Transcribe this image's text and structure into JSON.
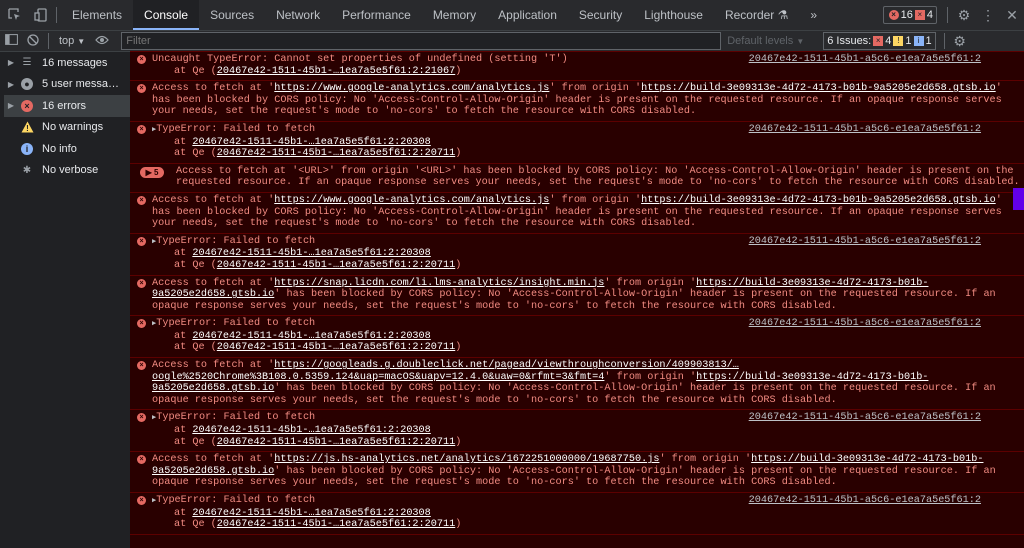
{
  "tabs": {
    "elements": "Elements",
    "console": "Console",
    "sources": "Sources",
    "network": "Network",
    "performance": "Performance",
    "memory": "Memory",
    "application": "Application",
    "security": "Security",
    "lighthouse": "Lighthouse",
    "recorder": "Recorder",
    "more": "»"
  },
  "header_badges": {
    "errors": "16",
    "issues": "4"
  },
  "toolbar": {
    "context": "top",
    "filter_placeholder": "Filter",
    "levels": "Default levels",
    "issues_label": "6 Issues:",
    "issues_err": "4",
    "issues_warn": "1",
    "issues_info": "1"
  },
  "sidebar": {
    "messages": "16 messages",
    "user": "5 user messa…",
    "errors": "16 errors",
    "warnings": "No warnings",
    "info": "No info",
    "verbose": "No verbose"
  },
  "log": {
    "src": "20467e42-1511-45b1-a5c6-e1ea7a5e5f61:2",
    "m1_text": "Uncaught TypeError: Cannot set properties of undefined (setting 'T')",
    "m1_at": "at Qe (",
    "m1_link": "20467e42-1511-45b1-…1ea7a5e5f61:2:21067",
    "tf_text": "TypeError: Failed to fetch",
    "tf_at1": "at ",
    "tf_link1": "20467e42-1511-45b1-…1ea7a5e5f61:2:20308",
    "tf_at2": "at Qe (",
    "tf_link2": "20467e42-1511-45b1-…1ea7a5e5f61:2:20711",
    "p_access": "Access to fetch at '",
    "p_from": "' from origin '",
    "p_blocked": "' has been blocked by CORS policy: No 'Access-Control-Allow-Origin' header is present on the requested resource. If an opaque response serves your needs, set the request's mode to 'no-cors' to fetch the resource with CORS disabled.",
    "origin": "https://build-3e09313e-4d72-4173-b01b-9a5205e2d658.gtsb.io",
    "ga_url": "https://www.google-analytics.com/analytics.js",
    "grp_count": "5",
    "grp_text": "Access to fetch at '<URL>' from origin '<URL>' has been blocked by CORS policy: No 'Access-Control-Allow-Origin' header is present on the requested resource. If an opaque response serves your needs, set the request's mode to 'no-cors' to fetch the resource with CORS disabled.",
    "li_url": "https://snap.licdn.com/li.lms-analytics/insight.min.js",
    "li_origin_a": "https://build-3e09313e-4d72-4173-b01b-9a5205e2d658.",
    "li_origin_b": "gtsb.io",
    "gads_url_a": "https://googleads.g.doubleclick.net/pagead/viewthroughconversion/409903813/…oogle%2520Chrome%3B108.0.5359.124&uap=macOS&",
    "gads_url_b": "uapv=12.4.0&uaw=0&rfmt=3&fmt=4",
    "hs_url": "https://js.hs-analytics.net/analytics/1672251000000/19687750.js",
    "hs_origin_a": "https://build-3e09313e-4d72-4173-b01b-9a52",
    "hs_origin_b": "05e2d658.gtsb.io"
  }
}
